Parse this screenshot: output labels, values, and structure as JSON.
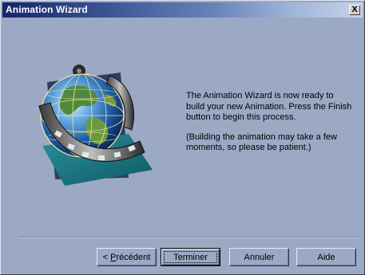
{
  "window": {
    "title": "Animation Wizard",
    "close_glyph": "X"
  },
  "message": {
    "line1": "The Animation Wizard is now ready to build your new Animation.  Press the Finish button to begin this process.",
    "line2": "(Building the animation may take a few moments, so please be patient.)"
  },
  "buttons": {
    "previous": {
      "prefix": "< ",
      "mnemonic": "P",
      "rest": "récédent"
    },
    "finish": "Terminer",
    "cancel": "Annuler",
    "help": "Aide"
  },
  "illustration": {
    "icon": "globe-film-reel-icon"
  },
  "colors": {
    "dialog_bg": "#9ba9c4",
    "titlebar_start": "#14266a",
    "titlebar_end": "#c6d3e8"
  }
}
